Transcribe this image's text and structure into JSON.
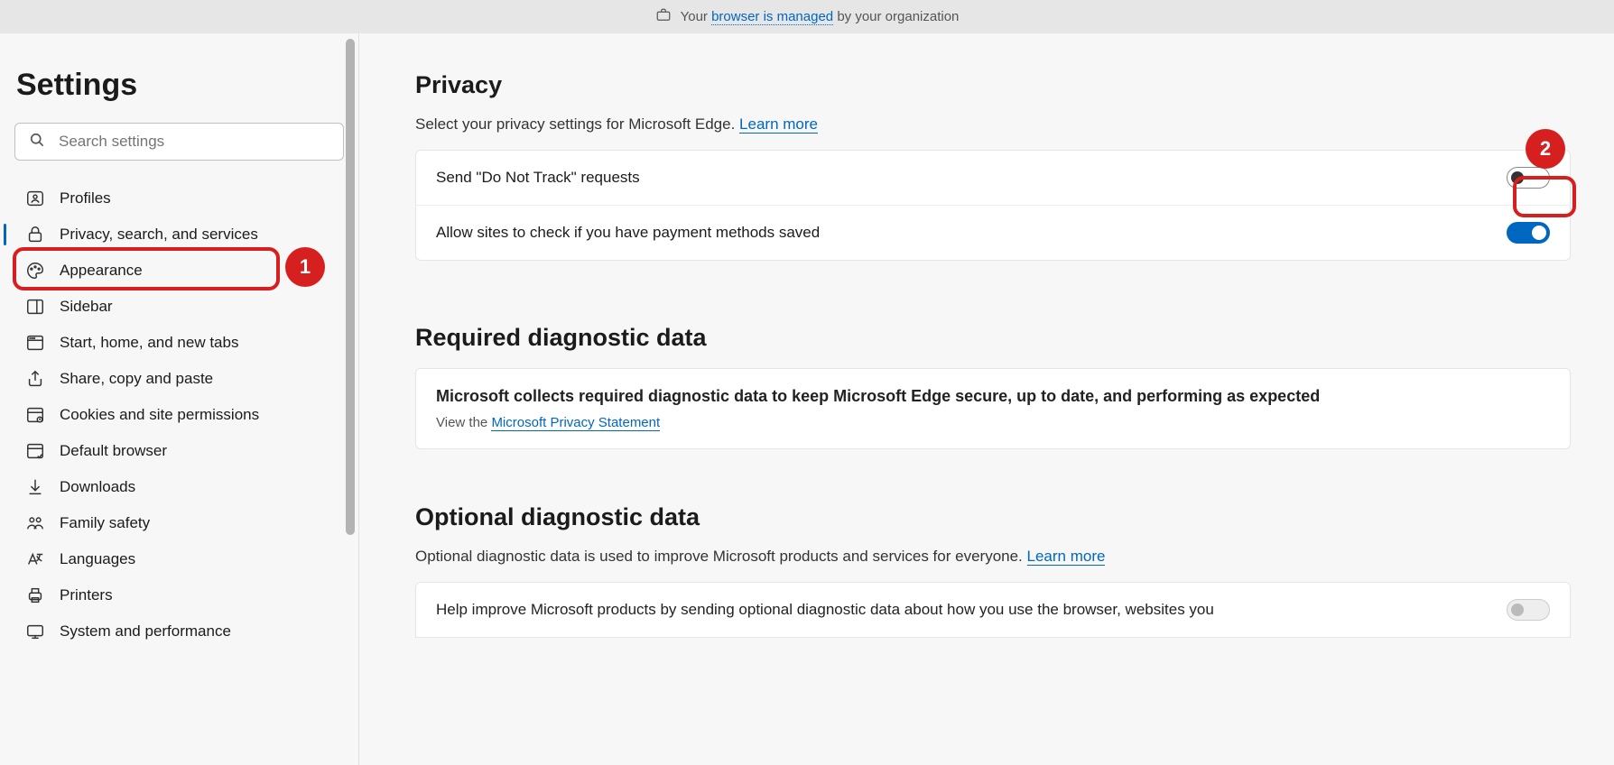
{
  "banner": {
    "prefix": "Your ",
    "link": "browser is managed",
    "suffix": " by your organization"
  },
  "sidebar": {
    "title": "Settings",
    "search_placeholder": "Search settings",
    "items": [
      {
        "label": "Profiles",
        "icon": "profiles"
      },
      {
        "label": "Privacy, search, and services",
        "icon": "lock",
        "active": true
      },
      {
        "label": "Appearance",
        "icon": "appearance"
      },
      {
        "label": "Sidebar",
        "icon": "sidebar"
      },
      {
        "label": "Start, home, and new tabs",
        "icon": "start"
      },
      {
        "label": "Share, copy and paste",
        "icon": "share"
      },
      {
        "label": "Cookies and site permissions",
        "icon": "cookies"
      },
      {
        "label": "Default browser",
        "icon": "default-browser"
      },
      {
        "label": "Downloads",
        "icon": "downloads"
      },
      {
        "label": "Family safety",
        "icon": "family"
      },
      {
        "label": "Languages",
        "icon": "languages"
      },
      {
        "label": "Printers",
        "icon": "printers"
      },
      {
        "label": "System and performance",
        "icon": "system"
      }
    ]
  },
  "callouts": {
    "one": "1",
    "two": "2"
  },
  "privacy": {
    "heading": "Privacy",
    "subtitle_prefix": "Select your privacy settings for Microsoft Edge. ",
    "learn_more": "Learn more",
    "dnt_label": "Send \"Do Not Track\" requests",
    "dnt_on": false,
    "payment_label": "Allow sites to check if you have payment methods saved",
    "payment_on": true
  },
  "required_diag": {
    "heading": "Required diagnostic data",
    "title": "Microsoft collects required diagnostic data to keep Microsoft Edge secure, up to date, and performing as expected",
    "view_prefix": "View the ",
    "privacy_statement": "Microsoft Privacy Statement"
  },
  "optional_diag": {
    "heading": "Optional diagnostic data",
    "subtitle_prefix": "Optional diagnostic data is used to improve Microsoft products and services for everyone. ",
    "learn_more": "Learn more",
    "row_label": "Help improve Microsoft products by sending optional diagnostic data about how you use the browser, websites you"
  }
}
